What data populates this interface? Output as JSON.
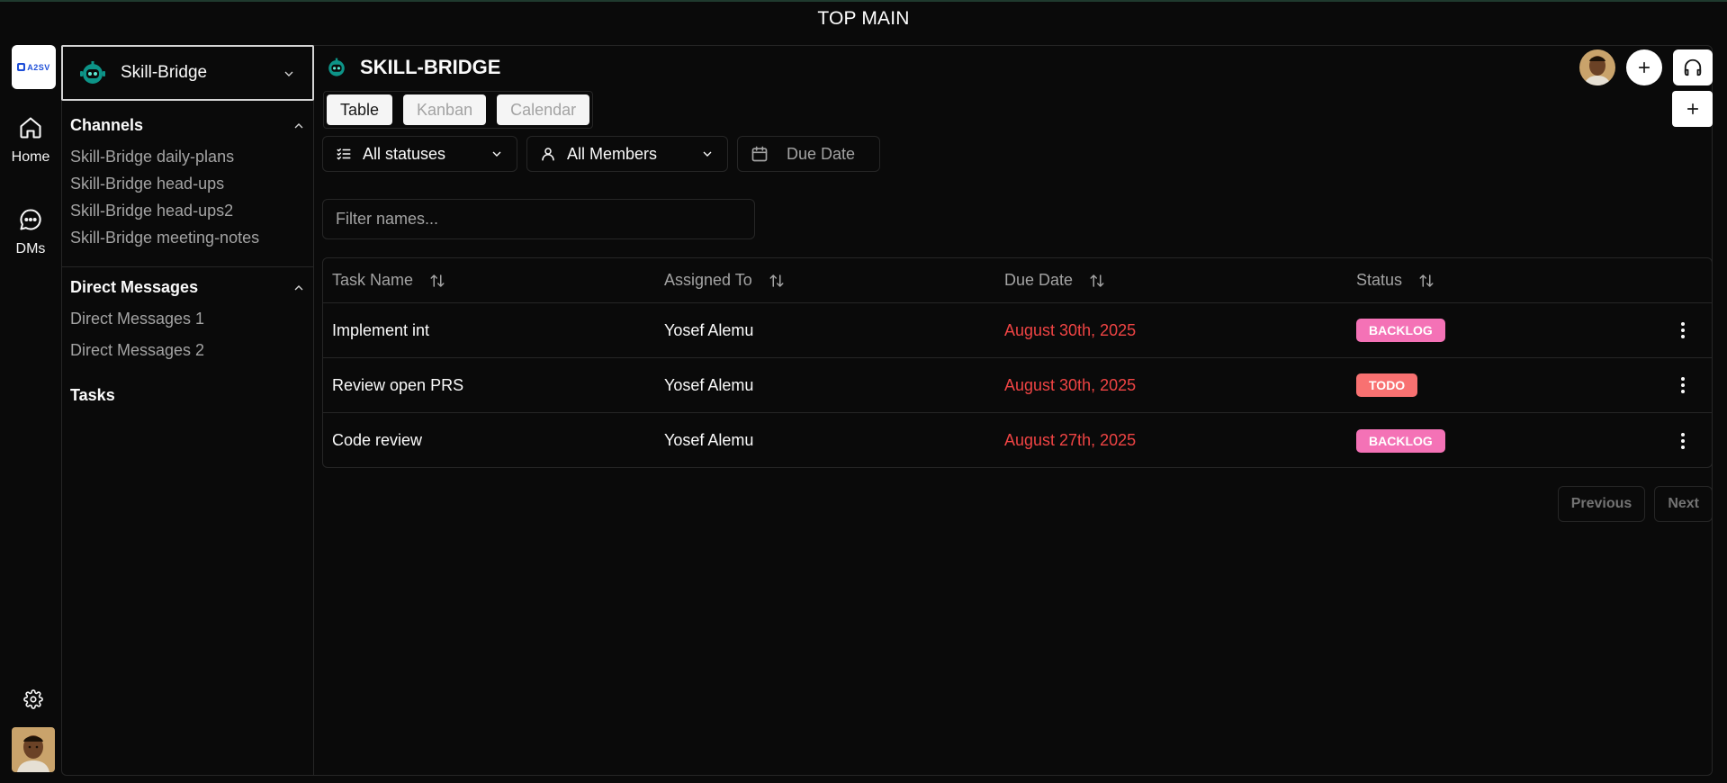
{
  "topbar": {
    "title": "TOP MAIN"
  },
  "rail": {
    "logo_text": "A2SV",
    "home_label": "Home",
    "dms_label": "DMs"
  },
  "sidebar": {
    "workspace": "Skill-Bridge",
    "channels_title": "Channels",
    "channels": [
      "Skill-Bridge daily-plans",
      "Skill-Bridge head-ups",
      "Skill-Bridge head-ups2",
      "Skill-Bridge meeting-notes"
    ],
    "dm_title": "Direct Messages",
    "dms": [
      "Direct Messages 1",
      "Direct Messages 2"
    ],
    "tasks_title": "Tasks"
  },
  "main": {
    "title": "SKILL-BRIDGE",
    "tabs": [
      "Table",
      "Kanban",
      "Calendar"
    ],
    "active_tab": "Table",
    "filters": {
      "status": "All statuses",
      "members": "All Members",
      "due_date": "Due Date"
    },
    "search_placeholder": "Filter names...",
    "columns": [
      "Task Name",
      "Assigned To",
      "Due Date",
      "Status"
    ],
    "rows": [
      {
        "task": "Implement int",
        "assignee": "Yosef Alemu",
        "due": "August 30th, 2025",
        "status": "BACKLOG"
      },
      {
        "task": "Review open PRS",
        "assignee": "Yosef Alemu",
        "due": "August 30th, 2025",
        "status": "TODO"
      },
      {
        "task": "Code review",
        "assignee": "Yosef Alemu",
        "due": "August 27th, 2025",
        "status": "BACKLOG"
      }
    ],
    "pager": {
      "previous": "Previous",
      "next": "Next"
    }
  },
  "colors": {
    "background": "#0a0a0a",
    "due_date": "#ef4444",
    "backlog_badge": "#f472b6",
    "todo_badge": "#f87171",
    "workspace_icon": "#0d9488"
  }
}
